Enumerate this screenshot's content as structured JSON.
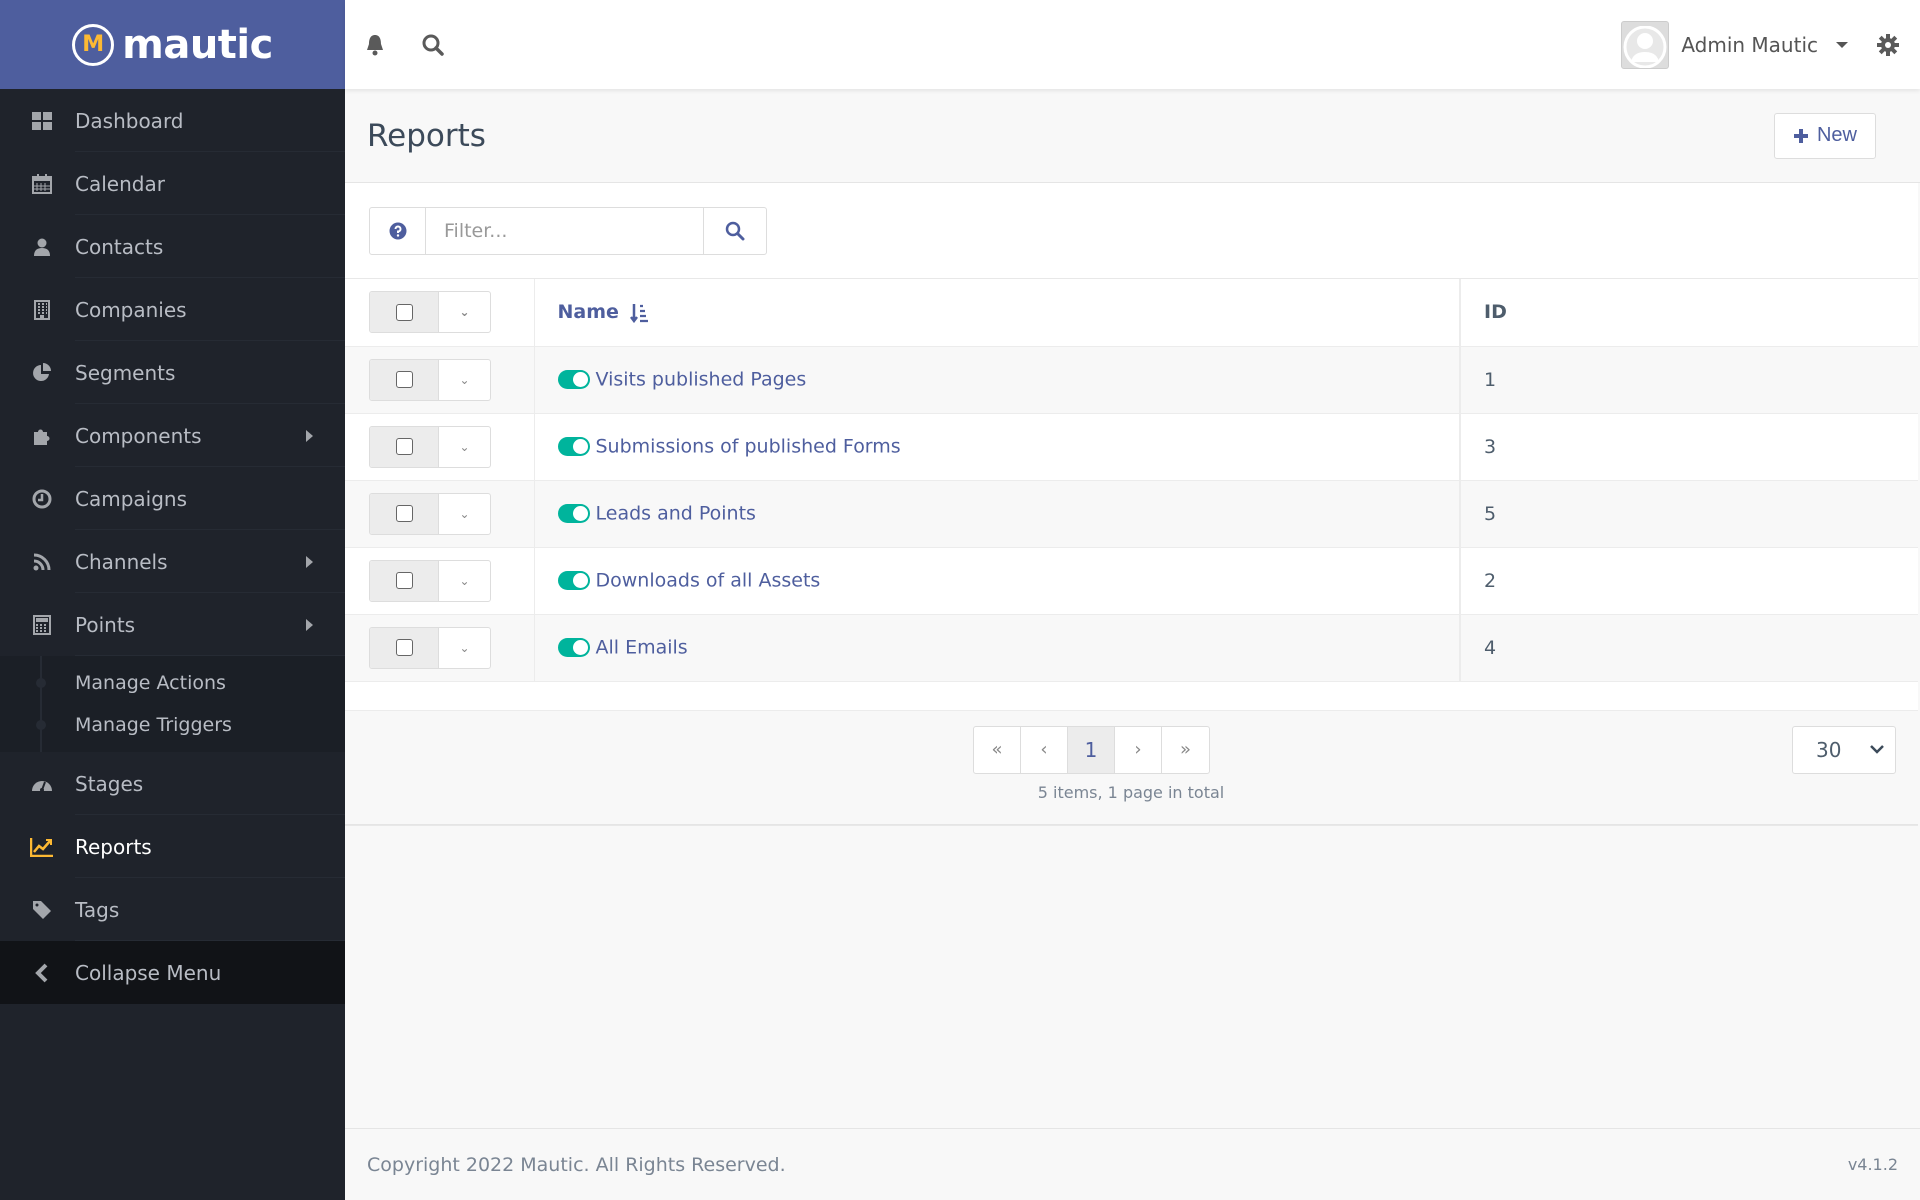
{
  "brand": {
    "name": "mautic",
    "logo_letter": "M"
  },
  "sidebar": {
    "items": [
      {
        "label": "Dashboard",
        "icon": "dashboard-icon",
        "has_submenu": false
      },
      {
        "label": "Calendar",
        "icon": "calendar-icon",
        "has_submenu": false
      },
      {
        "label": "Contacts",
        "icon": "user-icon",
        "has_submenu": false
      },
      {
        "label": "Companies",
        "icon": "building-icon",
        "has_submenu": false
      },
      {
        "label": "Segments",
        "icon": "pie-chart-icon",
        "has_submenu": false
      },
      {
        "label": "Components",
        "icon": "puzzle-icon",
        "has_submenu": true
      },
      {
        "label": "Campaigns",
        "icon": "clock-icon",
        "has_submenu": false
      },
      {
        "label": "Channels",
        "icon": "rss-icon",
        "has_submenu": true
      },
      {
        "label": "Points",
        "icon": "calculator-icon",
        "has_submenu": true
      },
      {
        "label": "Stages",
        "icon": "tachometer-icon",
        "has_submenu": false
      },
      {
        "label": "Reports",
        "icon": "line-chart-icon",
        "has_submenu": false,
        "active": true
      },
      {
        "label": "Tags",
        "icon": "tag-icon",
        "has_submenu": false
      }
    ],
    "points_submenu": [
      "Manage Actions",
      "Manage Triggers"
    ],
    "collapse_label": "Collapse Menu"
  },
  "header": {
    "user_name": "Admin Mautic"
  },
  "page": {
    "title": "Reports",
    "new_button": "New"
  },
  "filter": {
    "placeholder": "Filter...",
    "value": ""
  },
  "table": {
    "columns": {
      "name": "Name",
      "id": "ID"
    },
    "rows": [
      {
        "name": "Visits published Pages",
        "id": "1",
        "published": true
      },
      {
        "name": "Submissions of published Forms",
        "id": "3",
        "published": true
      },
      {
        "name": "Leads and Points",
        "id": "5",
        "published": true
      },
      {
        "name": "Downloads of all Assets",
        "id": "2",
        "published": true
      },
      {
        "name": "All Emails",
        "id": "4",
        "published": true
      }
    ]
  },
  "pagination": {
    "first": "«",
    "prev": "‹",
    "current": "1",
    "next": "›",
    "last": "»",
    "info": "5 items, 1 page in total",
    "limit": "30"
  },
  "footer": {
    "copyright": "Copyright 2022 Mautic. All Rights Reserved.",
    "version": "v4.1.2"
  },
  "colors": {
    "brand_bar": "#4e5e9e",
    "sidebar_bg": "#1f232b",
    "accent_yellow": "#fdb933",
    "toggle_green": "#00b49c",
    "link_blue": "#4e5e9e"
  }
}
